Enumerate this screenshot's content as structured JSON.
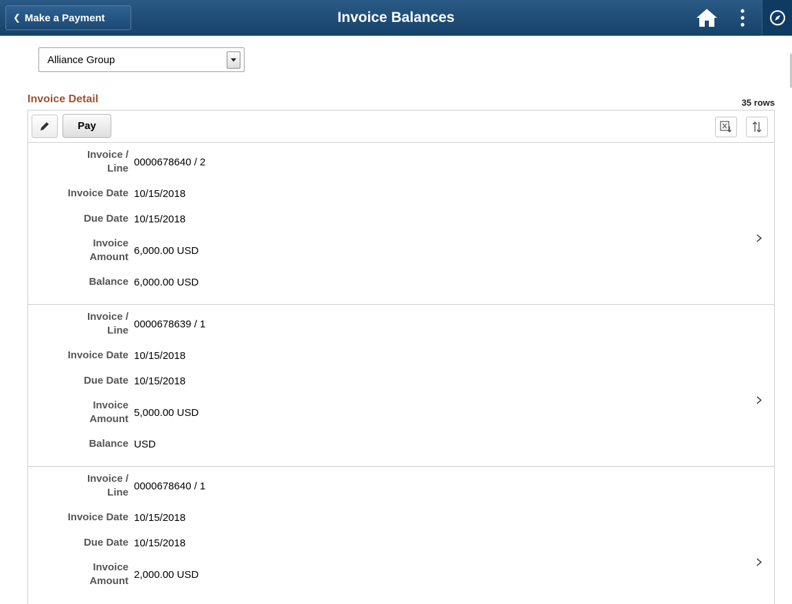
{
  "header": {
    "back_label": "Make a Payment",
    "title": "Invoice Balances"
  },
  "business_unit": {
    "selected": "Alliance Group"
  },
  "section": {
    "title": "Invoice Detail",
    "row_count": "35 rows",
    "pay_label": "Pay"
  },
  "labels": {
    "invoice_line_1": "Invoice /",
    "invoice_line_2": "Line",
    "invoice_date": "Invoice Date",
    "due_date": "Due Date",
    "invoice_amount_1": "Invoice",
    "invoice_amount_2": "Amount",
    "balance": "Balance"
  },
  "invoices": [
    {
      "invoice_line": "0000678640 / 2",
      "invoice_date": "10/15/2018",
      "due_date": "10/15/2018",
      "invoice_amount": "6,000.00 USD",
      "balance": "6,000.00 USD"
    },
    {
      "invoice_line": "0000678639 / 1",
      "invoice_date": "10/15/2018",
      "due_date": "10/15/2018",
      "invoice_amount": "5,000.00 USD",
      "balance": "USD"
    },
    {
      "invoice_line": "0000678640 / 1",
      "invoice_date": "10/15/2018",
      "due_date": "10/15/2018",
      "invoice_amount": "2,000.00 USD",
      "balance": ""
    }
  ],
  "icons": {
    "back": "chevron-left-icon",
    "home": "home-icon",
    "actions": "vertical-dots-icon",
    "navbar": "compass-icon",
    "edit": "pencil-icon",
    "excel": "excel-download-icon",
    "sort": "sort-icon",
    "row": "chevron-right-icon"
  },
  "colors": {
    "banner": "#1d4a72",
    "section_title": "#a0522d"
  }
}
